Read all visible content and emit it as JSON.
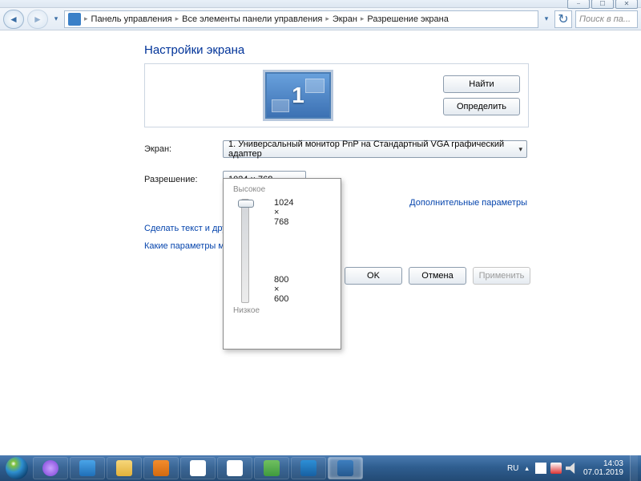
{
  "window_controls": {
    "min": "⎯",
    "max": "☐",
    "close": "✕"
  },
  "breadcrumbs": [
    "Панель управления",
    "Все элементы панели управления",
    "Экран",
    "Разрешение экрана"
  ],
  "refresh_glyph": "↻",
  "search_placeholder": "Поиск в па...",
  "title": "Настройки экрана",
  "monitor_number": "1",
  "side_buttons": {
    "find": "Найти",
    "detect": "Определить"
  },
  "labels": {
    "display": "Экран:",
    "resolution": "Разрешение:"
  },
  "display_combo": "1. Универсальный монитор PnP на Стандартный VGA графический адаптер",
  "resolution_combo": "1024 × 768",
  "res_popup": {
    "hi": "Высокое",
    "lo": "Низкое",
    "top": "1024 × 768",
    "bot": "800 × 600"
  },
  "links": {
    "textsize": "Сделать текст и другие",
    "which": "Какие параметры мон",
    "advanced": "Дополнительные параметры"
  },
  "buttons": {
    "ok": "OK",
    "cancel": "Отмена",
    "apply": "Применить"
  },
  "tray": {
    "lang": "RU",
    "time": "14:03",
    "date": "07.01.2019"
  },
  "taskbar_icons": [
    {
      "name": "ie",
      "bg": "linear-gradient(#4aa4e8,#1f6fb8)"
    },
    {
      "name": "explorer",
      "bg": "linear-gradient(#f7d77a,#e3b13a)"
    },
    {
      "name": "media",
      "bg": "linear-gradient(#f38c2c,#d46a10)"
    },
    {
      "name": "yandex-y",
      "bg": "#fff"
    },
    {
      "name": "yandex-browser",
      "bg": "#fff"
    },
    {
      "name": "green-app",
      "bg": "linear-gradient(#70c060,#3f9a3e)"
    },
    {
      "name": "notes",
      "bg": "linear-gradient(#2d8fd6,#1760a2)"
    },
    {
      "name": "control-panel",
      "bg": "linear-gradient(#3d7ebf,#25598f)",
      "active": true
    }
  ],
  "left_icons": [
    {
      "name": "voice",
      "bg": "radial-gradient(#c9a0ff,#7a3fd6)"
    }
  ]
}
